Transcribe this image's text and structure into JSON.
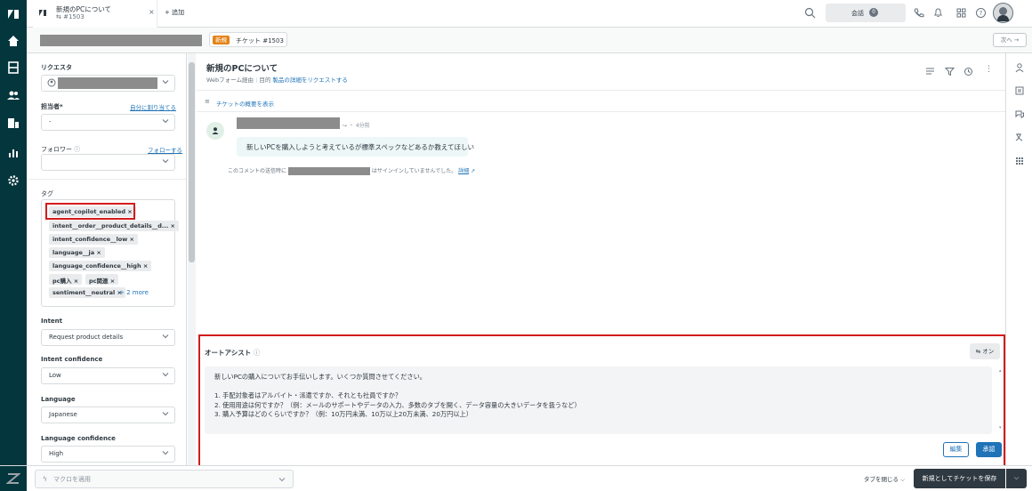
{
  "top_tab": {
    "title": "新規のPCについて",
    "subtitle": "#1503",
    "add_label": "+ 追加"
  },
  "top_right": {
    "chat_label": "会話",
    "chat_count": "0"
  },
  "subbar": {
    "badge": "新規",
    "ticket_label": "チケット #1503",
    "next_label": "次へ →"
  },
  "sidebar": {
    "requester_label": "リクエスタ",
    "assignee_label": "担当者*",
    "assign_self_link": "自分に割り当てる",
    "assignee_value": "-",
    "follower_label": "フォロワー",
    "follow_link": "フォローする",
    "tags_label": "タグ",
    "tags": [
      "agent_copilot_enabled ×",
      "intent__order__product_details__d... ×",
      "intent_confidence__low ×",
      "language__ja ×",
      "language_confidence__high ×",
      "pc購入 ×",
      "pc関連 ×",
      "sentiment__neutral ×"
    ],
    "more_tags": "+ 2 more",
    "intent_label": "Intent",
    "intent_value": "Request product details",
    "intent_conf_label": "Intent confidence",
    "intent_conf_value": "Low",
    "language_label": "Language",
    "language_value": "Japanese",
    "lang_conf_label": "Language confidence",
    "lang_conf_value": "High"
  },
  "ticket": {
    "title": "新規のPCについて",
    "meta_prefix": "Webフォーム経由",
    "meta_sep": "目的",
    "meta_link": "製品の詳細をリクエストする",
    "summary_link": "チケットの概要を表示",
    "comment_time": "4分前",
    "comment_body": "新しいPCを購入しようと考えているが標準スペックなどあるか教えてほしい",
    "signin_prefix": "このコメントの送信時に",
    "signin_suffix": "はサインインしていませんでした。",
    "signin_link": "詳細"
  },
  "autoassist": {
    "title": "オートアシスト",
    "toggle_label": "オン",
    "lines": [
      "新しいPCの購入についてお手伝いします。いくつか質問させてください。",
      "",
      "1. 手配対象者はアルバイト・派遣ですか、それとも社員ですか？",
      "2. 使用用途は何ですか？（例：メールのサポートやデータの入力、多数のタブを開く、データ容量の大きいデータを扱うなど）",
      "3. 購入予算はどのくらいですか？（例：10万円未満、10万以上20万未満、20万円以上）"
    ],
    "edit_label": "編集",
    "approve_label": "承認"
  },
  "bottom": {
    "macro_placeholder": "マクロを適用",
    "close_tab_label": "タブを閉じる",
    "submit_label": "新規としてチケットを保存"
  },
  "colors": {
    "nav_bg": "#03363d",
    "accent_blue": "#1f73b7",
    "highlight_red": "#d21c1c",
    "badge_orange": "#e38215",
    "submit_bg": "#2f3941"
  }
}
